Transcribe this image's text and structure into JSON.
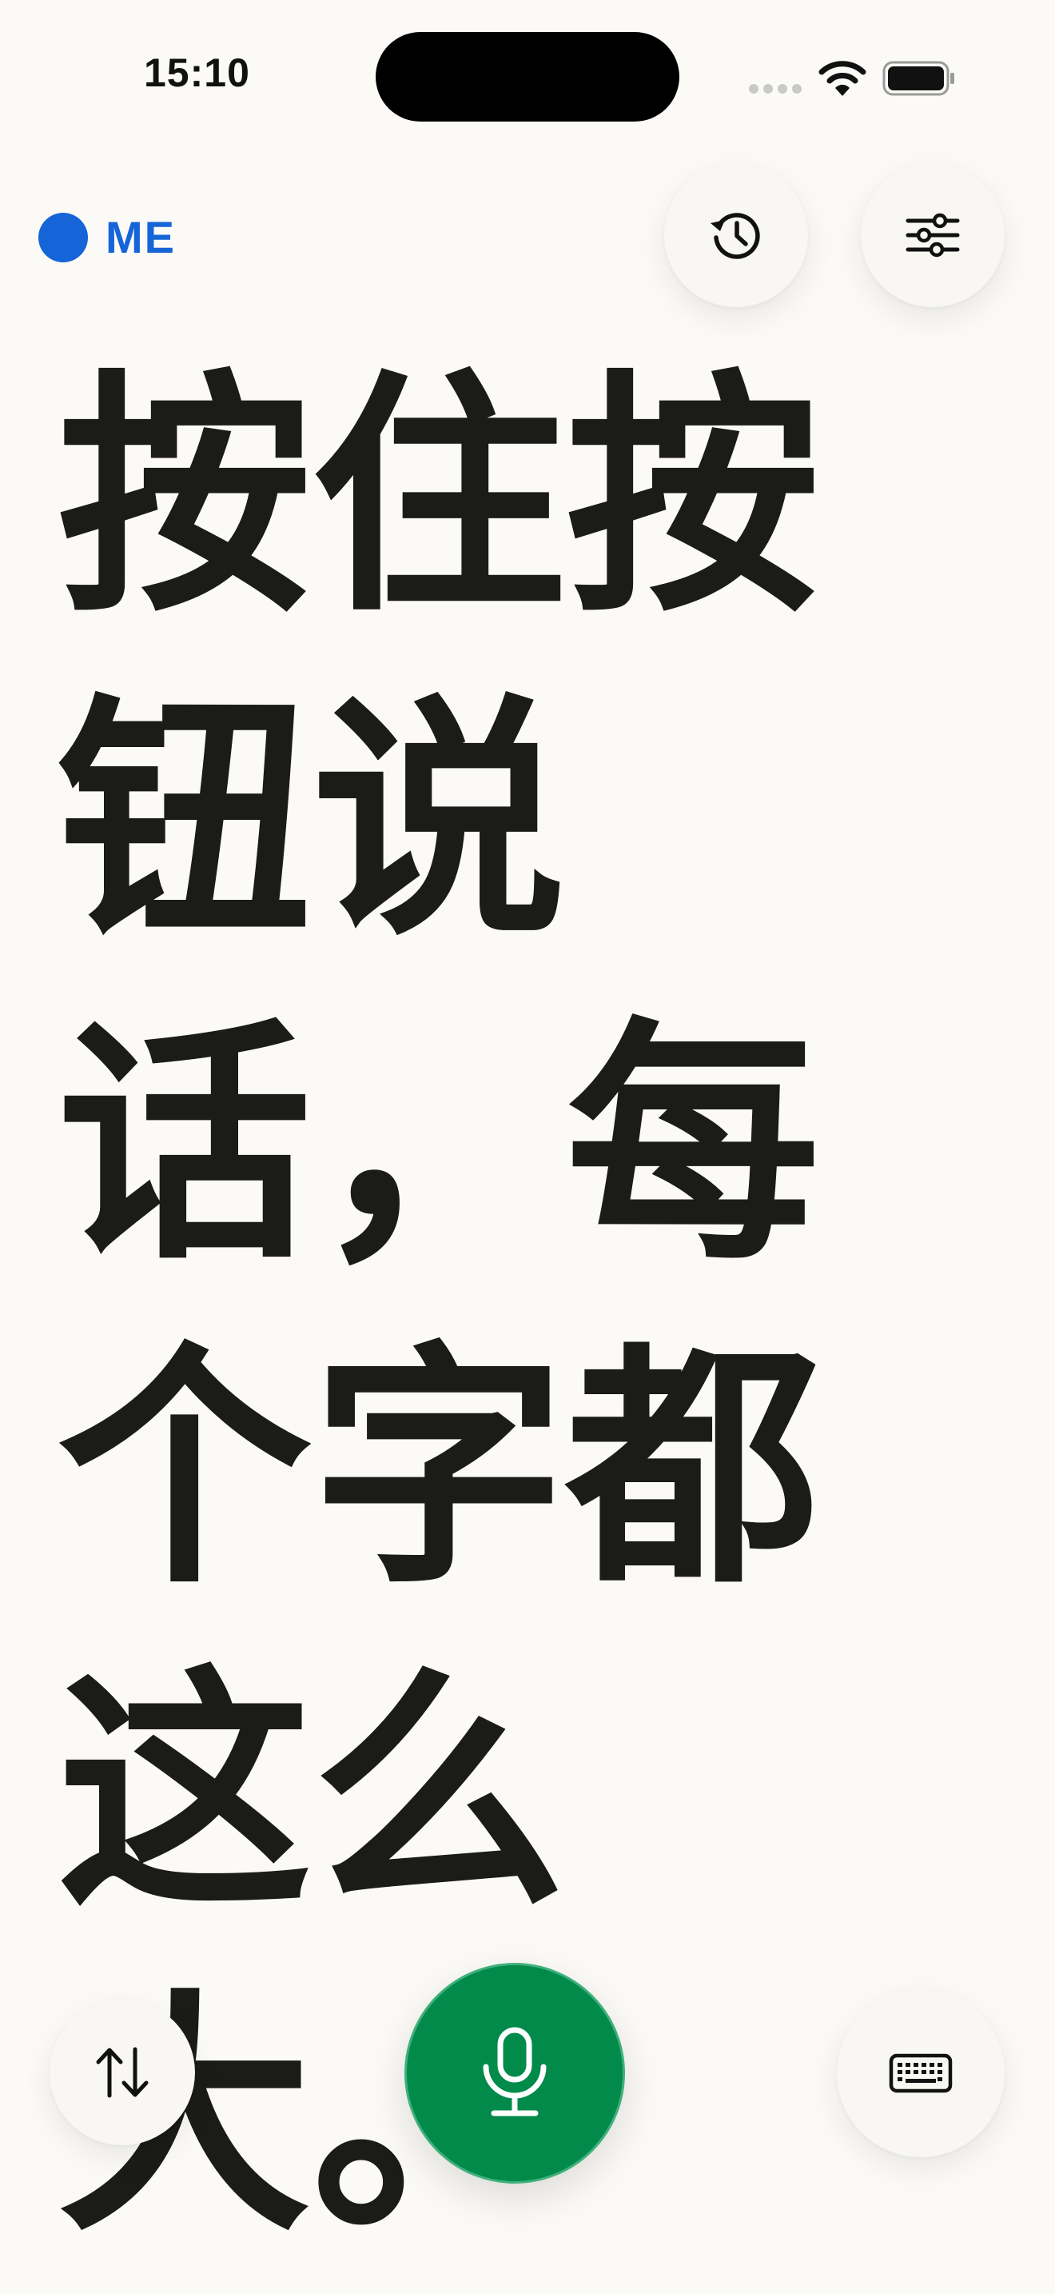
{
  "status_bar": {
    "time": "15:10"
  },
  "header": {
    "speaker_label": "ME",
    "speaker_color": "#1565d8"
  },
  "icons": {
    "history": "history-clock-icon",
    "settings": "sliders-icon",
    "swap": "swap-arrows-icon",
    "mic": "microphone-icon",
    "keyboard": "keyboard-icon"
  },
  "transcript": {
    "text": "按住按钮说话，每个字都这么大。"
  },
  "colors": {
    "background": "#fbfaf6",
    "mic_button": "#028a4a",
    "text": "#1b1b19"
  }
}
